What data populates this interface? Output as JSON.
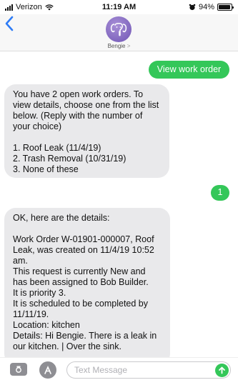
{
  "status_bar": {
    "carrier": "Verizon",
    "time": "11:19 AM",
    "battery": "94%",
    "battery_level": 0.94
  },
  "header": {
    "back_icon": "chevron-left-icon",
    "contact_name": "Bengie",
    "contact_chevron": ">",
    "avatar_icon": "elephant-icon"
  },
  "messages": [
    {
      "direction": "outgoing",
      "text": "View work order"
    },
    {
      "direction": "incoming",
      "text": "You have 2 open work orders. To view details, choose one from the list below. (Reply with the number of your choice)\n\n1. Roof Leak (11/4/19)\n2. Trash Removal (10/31/19)\n3. None of these"
    },
    {
      "direction": "outgoing",
      "text": "1"
    },
    {
      "direction": "incoming",
      "text": "OK, here are the details:\n\nWork Order W-01901-000007, Roof Leak, was created on 11/4/19 10:52 am.\nThis request is currently New and has been assigned to Bob Builder.\nIt is priority 3.\nIt is scheduled to be completed by 11/11/19.\nLocation: kitchen\nDetails: Hi Bengie. There is a leak in our kitchen.  | Over the sink."
    }
  ],
  "composer": {
    "placeholder": "Text Message",
    "value": "",
    "camera_icon": "camera-icon",
    "apps_icon": "app-store-icon",
    "send_icon": "arrow-up-icon"
  },
  "colors": {
    "outgoing_bubble": "#34c759",
    "incoming_bubble": "#e9e9eb",
    "accent": "#2f7cf6"
  }
}
